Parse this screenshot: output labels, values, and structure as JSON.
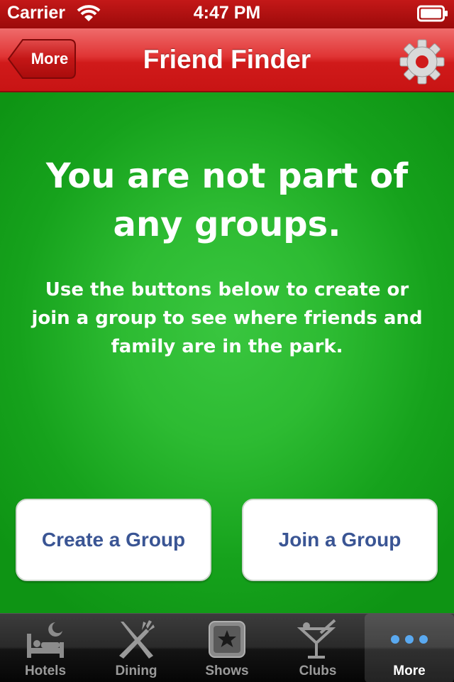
{
  "status_bar": {
    "carrier": "Carrier",
    "time": "4:47 PM"
  },
  "nav": {
    "back_label": "More",
    "title": "Friend Finder"
  },
  "main": {
    "headline": "You are not part of any groups.",
    "subtext": "Use the buttons below to create or join a group to see where friends and family are in the park.",
    "create_button": "Create a Group",
    "join_button": "Join a Group"
  },
  "tabs": [
    {
      "label": "Hotels",
      "icon": "bed-icon",
      "active": false
    },
    {
      "label": "Dining",
      "icon": "fork-knife-icon",
      "active": false
    },
    {
      "label": "Shows",
      "icon": "star-icon",
      "active": false
    },
    {
      "label": "Clubs",
      "icon": "cocktail-icon",
      "active": false
    },
    {
      "label": "More",
      "icon": "more-dots-icon",
      "active": true
    }
  ],
  "colors": {
    "nav_red": "#d42020",
    "main_green": "#22b128",
    "button_text": "#3a5594"
  }
}
